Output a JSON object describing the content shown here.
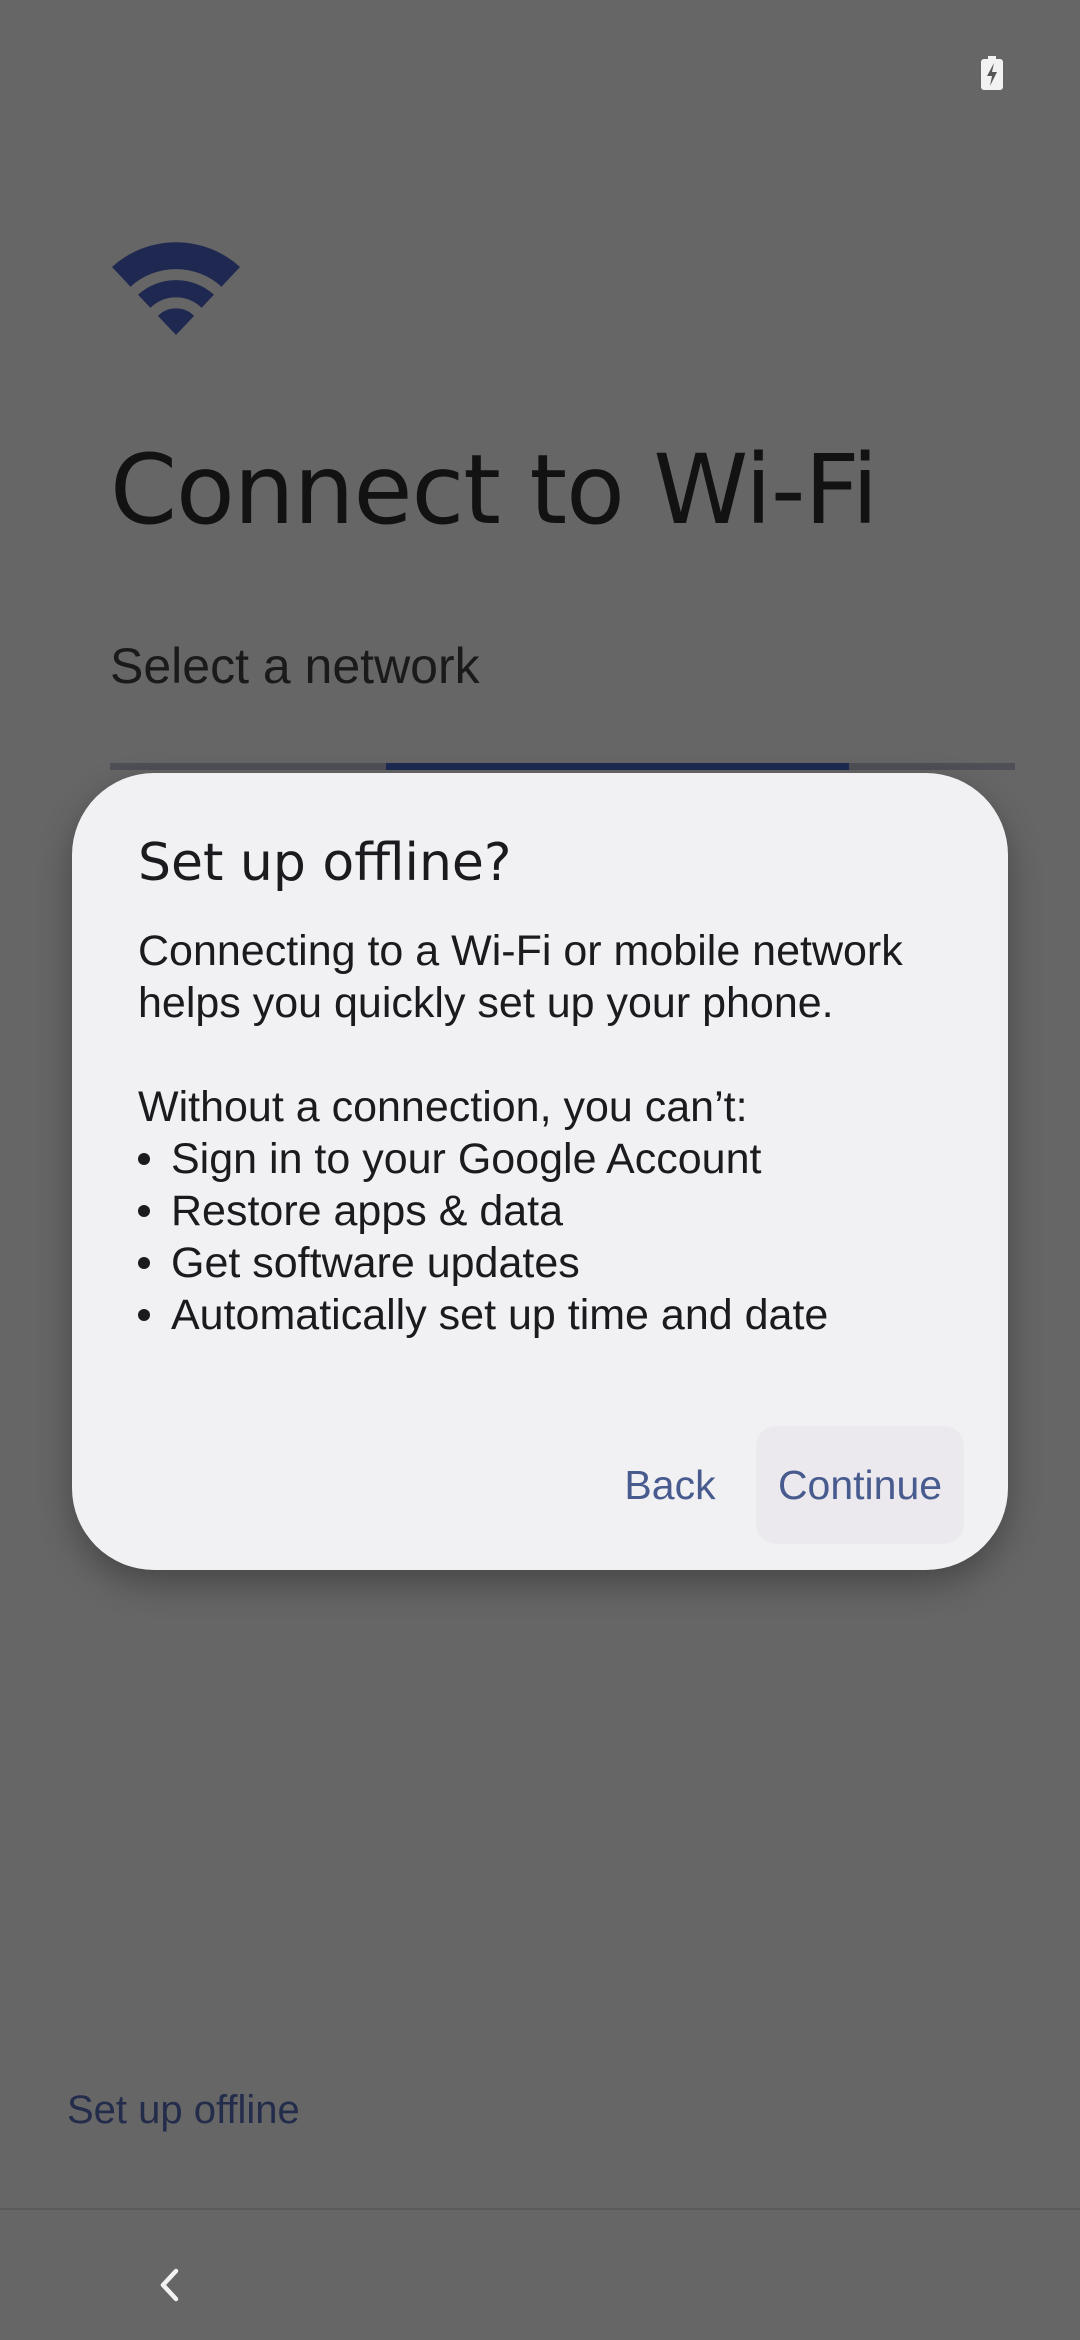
{
  "page": {
    "title": "Connect to Wi-Fi",
    "subtitle": "Select a network",
    "offline_link": "Set up offline"
  },
  "status_bar": {
    "battery_icon": "battery-charging-icon"
  },
  "hero_icon": "wifi-icon",
  "dialog": {
    "title": "Set up offline?",
    "body_line_1": "Connecting to a Wi-Fi or mobile network",
    "body_line_2": "helps you quickly set up your phone.",
    "list_intro": "Without a connection, you can’t:",
    "list_items": [
      "Sign in to your Google Account",
      "Restore apps & data",
      "Get software updates",
      "Automatically set up time and date"
    ],
    "back_label": "Back",
    "continue_label": "Continue"
  },
  "nav_bar": {
    "back_icon": "chevron-left-icon"
  },
  "colors": {
    "scrim_background": "#666666",
    "dialog_background": "#f1f0f3",
    "accent_text": "#485b8e",
    "hero_icon": "#1f2850",
    "progress_fill": "#1d2a52"
  }
}
